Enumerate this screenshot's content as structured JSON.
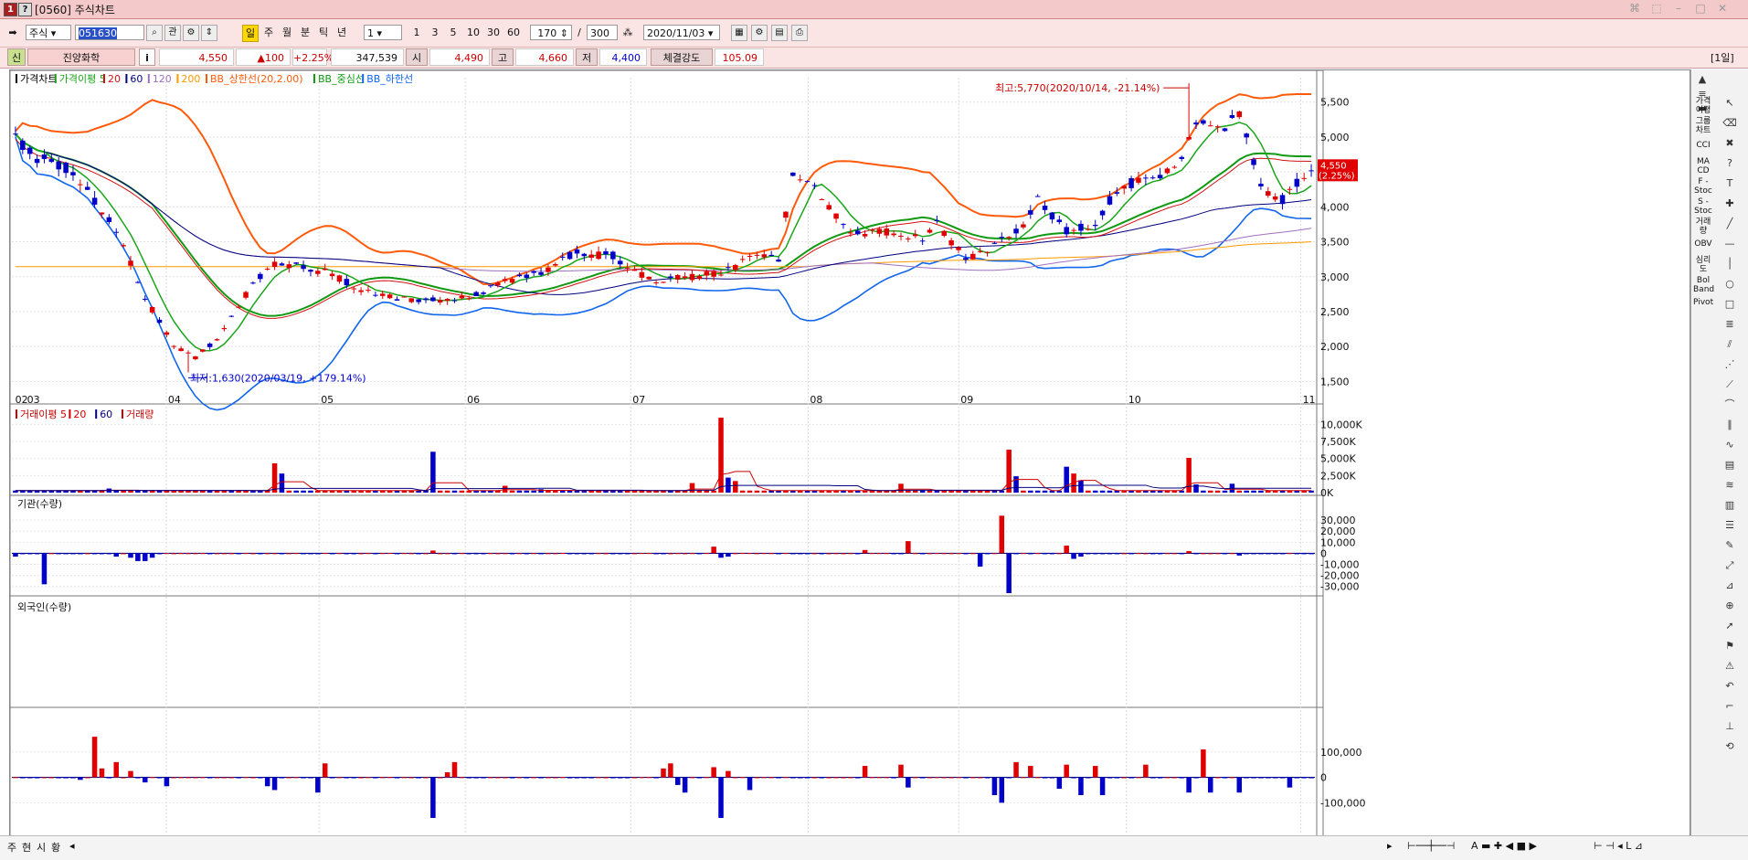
{
  "window": {
    "title": "[0560] 주식차트",
    "period_badge": "[1일]"
  },
  "toolbar": {
    "market_type": "주식",
    "stock_code": "051630",
    "search_btn": "관",
    "period_buttons": [
      "주",
      "월",
      "분",
      "틱",
      "년"
    ],
    "interval_select": "1",
    "interval_buttons": [
      "1",
      "3",
      "5",
      "10",
      "30",
      "60"
    ],
    "display_count": "170",
    "separator": "/",
    "total_count": "300",
    "date": "2020/11/03"
  },
  "quote": {
    "badge": "신",
    "name": "진양화학",
    "info_icon": "i",
    "price": "4,550",
    "change": "▲100",
    "change_pct": "+2.25%",
    "volume": "347,539",
    "open_label": "시",
    "open": "4,490",
    "high_label": "고",
    "high": "4,660",
    "low_label": "저",
    "low": "4,400",
    "strength_label": "체결강도",
    "strength": "105.09"
  },
  "colors": {
    "up": "#e00000",
    "down": "#0000c8",
    "ma5": "#1aa51a",
    "ma20": "#d01010",
    "ma60": "#000080",
    "ma120": "#a070c0",
    "ma200": "#ff9900",
    "bb_upper": "#ff5a0a",
    "bb_mid": "#119911",
    "bb_lower": "#1166ee"
  },
  "chart_data": [
    {
      "type": "candlestick",
      "title": "가격차트",
      "legend": [
        "가격이평 5",
        "20",
        "60",
        "120",
        "200",
        "BB_상한선(20,2.00)",
        "BB_중심선",
        "BB_하한선"
      ],
      "x_ticks": [
        "02",
        "03",
        "04",
        "05",
        "06",
        "07",
        "08",
        "09",
        "10",
        "11"
      ],
      "y_ticks": [
        "5,500",
        "5,000",
        "4,500",
        "4,000",
        "3,500",
        "3,000",
        "2,500",
        "2,000",
        "1,500"
      ],
      "ylim": [
        1400,
        5850
      ],
      "annotations": {
        "high": "최고:5,770(2020/10/14, -21.14%)",
        "low": "최저:1,630(2020/03/19, +179.14%)"
      },
      "last_price_label": "4,550",
      "last_change_label": "(2.25%)",
      "anchors": [
        [
          0,
          4980
        ],
        [
          3,
          4700
        ],
        [
          8,
          4500
        ],
        [
          14,
          3700
        ],
        [
          18,
          2700
        ],
        [
          22,
          2000
        ],
        [
          25,
          1850
        ],
        [
          28,
          2100
        ],
        [
          33,
          2900
        ],
        [
          36,
          3200
        ],
        [
          44,
          3050
        ],
        [
          48,
          2800
        ],
        [
          52,
          2700
        ],
        [
          58,
          2650
        ],
        [
          63,
          2700
        ],
        [
          68,
          2950
        ],
        [
          73,
          3050
        ],
        [
          78,
          3350
        ],
        [
          83,
          3300
        ],
        [
          88,
          2950
        ],
        [
          93,
          3000
        ],
        [
          98,
          3050
        ],
        [
          103,
          3300
        ],
        [
          106,
          3250
        ],
        [
          108,
          4500
        ],
        [
          111,
          4300
        ],
        [
          116,
          3600
        ],
        [
          121,
          3650
        ],
        [
          126,
          3550
        ],
        [
          128,
          3750
        ],
        [
          132,
          3250
        ],
        [
          136,
          3450
        ],
        [
          140,
          3700
        ],
        [
          142,
          4100
        ],
        [
          146,
          3650
        ],
        [
          150,
          3750
        ],
        [
          153,
          4250
        ],
        [
          157,
          4400
        ],
        [
          161,
          4550
        ],
        [
          164,
          5200
        ],
        [
          168,
          5100
        ],
        [
          170,
          5350
        ],
        [
          173,
          4300
        ],
        [
          176,
          4100
        ],
        [
          180,
          4550
        ]
      ],
      "ma_indices": [
        [
          5,
          "ma5"
        ],
        [
          20,
          "ma20"
        ],
        [
          60,
          "ma60"
        ],
        [
          120,
          "ma120"
        ],
        [
          200,
          "ma200"
        ]
      ],
      "daily_moves": [
        0.0216,
        -0.0242,
        -0.0123,
        -0.0251,
        0.0087,
        0.0084,
        -0.0158,
        -0.0198,
        -0.0181,
        -0.0163,
        0.0039,
        -0.0275,
        -0.0199,
        -0.0221,
        -0.0292,
        0.0008,
        0.0152,
        -0.0179,
        -0.0104,
        0.0265,
        -0.0066,
        0.0225,
        0.0062,
        0.0192,
        0.0126,
        0.0085,
        0.0213,
        -0.0206,
        0.0039,
        0.0033,
        0.0104,
        -0.0074,
        0.0246,
        0.0049,
        -0.0182,
        0.0081,
        0.0072,
        -0.0109,
        0.0082,
        0.0216,
        -0.0073,
        -0.0185,
        -0.0016,
        0.0263,
        -0.0039,
        0.0174,
        -0.0271,
        -0.0174,
        0.0033,
        0.0223,
        -0.0128,
        0.0194,
        0.0279,
        -0.0212,
        0.0191,
        0.0098,
        -0.0189,
        0.0052,
        0.0004,
        0.0041,
        0.0074,
        -0.0162,
        0.0212,
        -0.0051,
        -0.0164,
        -0.0286,
        0.0155,
        0.0081,
        0.0092,
        -0.0003,
        0.0101,
        -0.0154,
        0.0135,
        -0.0133,
        0.0116,
        0.0057,
        0.0271,
        -0.0184,
        -0.0092,
        -0.0228,
        -0.0066,
        0.0196,
        0.0047,
        -0.0248,
        -0.0276,
        -0.0173,
        0.0052,
        0.0251,
        0.0279,
        -0.0234,
        -0.0251,
        0.0011,
        0.0185,
        0.0028,
        0.0162,
        -0.0062,
        0.0237,
        0.0234,
        -0.0113,
        0.0148,
        0.0089,
        0.0277,
        0.0244,
        0.0064,
        0.0191,
        0.0155,
        -0.0174,
        0.0239,
        -0.0209,
        -0.0153,
        -0.0027,
        0.0022,
        -0.02,
        0.0024,
        0.0107,
        0.0032,
        0.0148,
        -0.0009,
        -0.0041,
        0.0206,
        0.0203,
        0.0184,
        -0.0056,
        -0.0108,
        -0.0195,
        0.0168,
        -0.0159,
        0.0098,
        0.0231,
        0.0137,
        0.0101,
        0.0219,
        -0.0045,
        0.0133,
        0.0074,
        -0.0225,
        0.0157,
        0.0205,
        -0.0024,
        -0.0081,
        0.0222,
        -0.0045,
        0.0217,
        -0.0138,
        -0.0238,
        0.0085,
        -0.0195,
        -0.0025,
        -0.0188,
        -0.0189,
        -0.0105,
        -0.0161,
        -0.0206,
        -0.0239,
        0.0047,
        -0.0221,
        0.0206,
        0.0029,
        -0.0101,
        -0.0245,
        0.0135,
        0.0085,
        -0.0282,
        0.0054,
        -0.0061,
        0.0053,
        0.0053,
        0.0092,
        -0.0044,
        0.0157,
        0.0052,
        -0.0019,
        -0.018,
        -0.0027,
        -0.0035,
        -0.0069,
        -0.0241,
        0.0173,
        -0.0141,
        -0.0093,
        -0.0103,
        0.0247
      ]
    },
    {
      "type": "bar",
      "title": "거래이평 5",
      "legend": [
        "거래이평 5",
        "20",
        "60",
        "거래량"
      ],
      "y_ticks": [
        "10,000K",
        "7,500K",
        "5,000K",
        "2,500K",
        "0K"
      ],
      "ylim": [
        0,
        11000000
      ],
      "spikes": [
        [
          13,
          600000
        ],
        [
          36,
          4300000
        ],
        [
          37,
          2800000
        ],
        [
          58,
          6000000
        ],
        [
          68,
          1000000
        ],
        [
          73,
          500000
        ],
        [
          94,
          1400000
        ],
        [
          98,
          11000000
        ],
        [
          99,
          2200000
        ],
        [
          100,
          1700000
        ],
        [
          123,
          1300000
        ],
        [
          138,
          6300000
        ],
        [
          139,
          2400000
        ],
        [
          146,
          3800000
        ],
        [
          147,
          2800000
        ],
        [
          148,
          1800000
        ],
        [
          163,
          5100000
        ],
        [
          164,
          1200000
        ],
        [
          169,
          1300000
        ]
      ],
      "base": 300000
    },
    {
      "type": "bar",
      "title": "기관(수량)",
      "y_ticks": [
        "30,000",
        "20,000",
        "10,000",
        "0",
        "-10,000",
        "-20,000",
        "-30,000"
      ],
      "ylim": [
        -36000,
        40000
      ],
      "spikes": [
        [
          0,
          -3000
        ],
        [
          4,
          -28000
        ],
        [
          14,
          -3000
        ],
        [
          16,
          -4000
        ],
        [
          17,
          -7000
        ],
        [
          18,
          -7000
        ],
        [
          19,
          -4000
        ],
        [
          58,
          2500
        ],
        [
          97,
          6000
        ],
        [
          98,
          -4000
        ],
        [
          99,
          -3000
        ],
        [
          118,
          3000
        ],
        [
          124,
          11000
        ],
        [
          134,
          -12000
        ],
        [
          137,
          34000
        ],
        [
          138,
          -36000
        ],
        [
          146,
          7000
        ],
        [
          147,
          -5000
        ],
        [
          148,
          -3000
        ],
        [
          163,
          2000
        ],
        [
          170,
          -2000
        ]
      ]
    },
    {
      "type": "bar",
      "title": "외국인(수량)",
      "y_ticks": [
        "100,000",
        "0",
        "-100,000"
      ],
      "ylim": [
        -160000,
        200000
      ],
      "spikes": [
        [
          9,
          -10000
        ],
        [
          11,
          160000
        ],
        [
          12,
          35000
        ],
        [
          14,
          60000
        ],
        [
          16,
          25000
        ],
        [
          18,
          -20000
        ],
        [
          21,
          -35000
        ],
        [
          35,
          -35000
        ],
        [
          36,
          -50000
        ],
        [
          42,
          -60000
        ],
        [
          43,
          55000
        ],
        [
          58,
          -160000
        ],
        [
          60,
          20000
        ],
        [
          61,
          60000
        ],
        [
          90,
          35000
        ],
        [
          91,
          55000
        ],
        [
          92,
          -30000
        ],
        [
          93,
          -60000
        ],
        [
          97,
          40000
        ],
        [
          98,
          -160000
        ],
        [
          99,
          25000
        ],
        [
          102,
          -50000
        ],
        [
          118,
          45000
        ],
        [
          123,
          50000
        ],
        [
          124,
          -40000
        ],
        [
          136,
          -70000
        ],
        [
          137,
          -100000
        ],
        [
          139,
          60000
        ],
        [
          141,
          45000
        ],
        [
          145,
          -45000
        ],
        [
          146,
          50000
        ],
        [
          148,
          -70000
        ],
        [
          150,
          45000
        ],
        [
          151,
          -70000
        ],
        [
          157,
          50000
        ],
        [
          163,
          -60000
        ],
        [
          165,
          110000
        ],
        [
          166,
          -60000
        ],
        [
          170,
          -60000
        ],
        [
          177,
          -40000
        ]
      ]
    }
  ],
  "bottom": {
    "tabs": [
      "주",
      "현",
      "시",
      "황"
    ]
  }
}
